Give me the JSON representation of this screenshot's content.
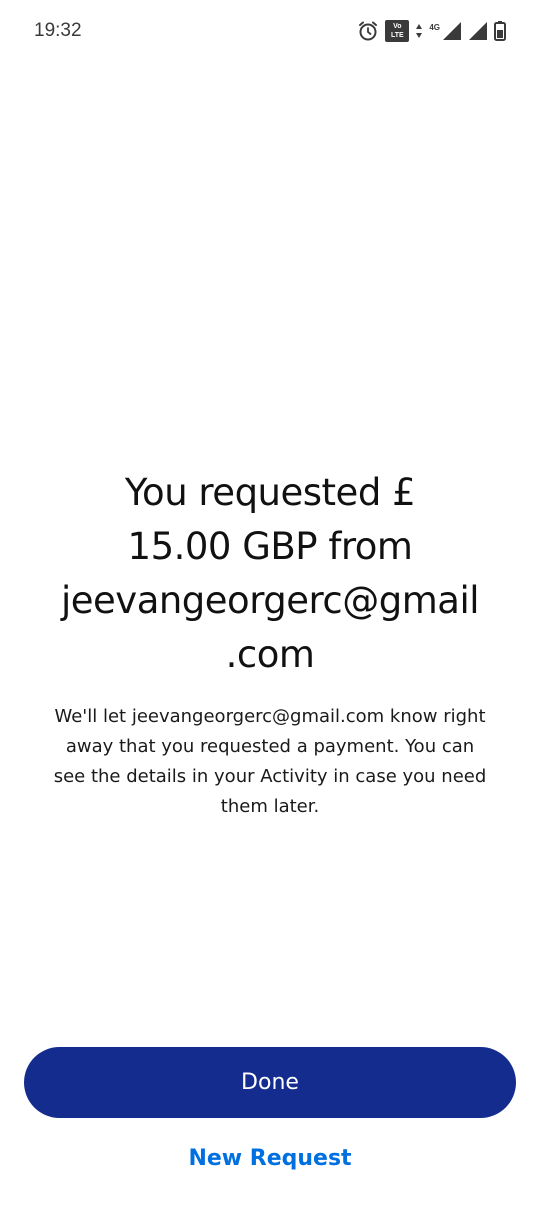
{
  "status_bar": {
    "time": "19:32",
    "icons": [
      "alarm-icon",
      "volte-icon",
      "data-arrows-icon",
      "signal-icon",
      "signal-icon",
      "battery-icon"
    ],
    "network_label": "4G",
    "volte_line1": "Vo",
    "volte_line2": "LTE"
  },
  "confirmation": {
    "headline_line1": "You requested £",
    "headline_line2": "15.00 GBP from",
    "headline_line3": "jeevangeorgerc@gmail",
    "headline_line4": ".com",
    "message_line1": "We'll let jeevangeorgerc@gmail.com know right",
    "message_line2": "away that you requested a payment. You can",
    "message_line3": "see the details in your Activity in case you need",
    "message_line4": "them later."
  },
  "actions": {
    "done_label": "Done",
    "new_request_label": "New Request"
  },
  "colors": {
    "primary_button": "#142c8e",
    "link": "#0070e0",
    "text": "#111111"
  }
}
